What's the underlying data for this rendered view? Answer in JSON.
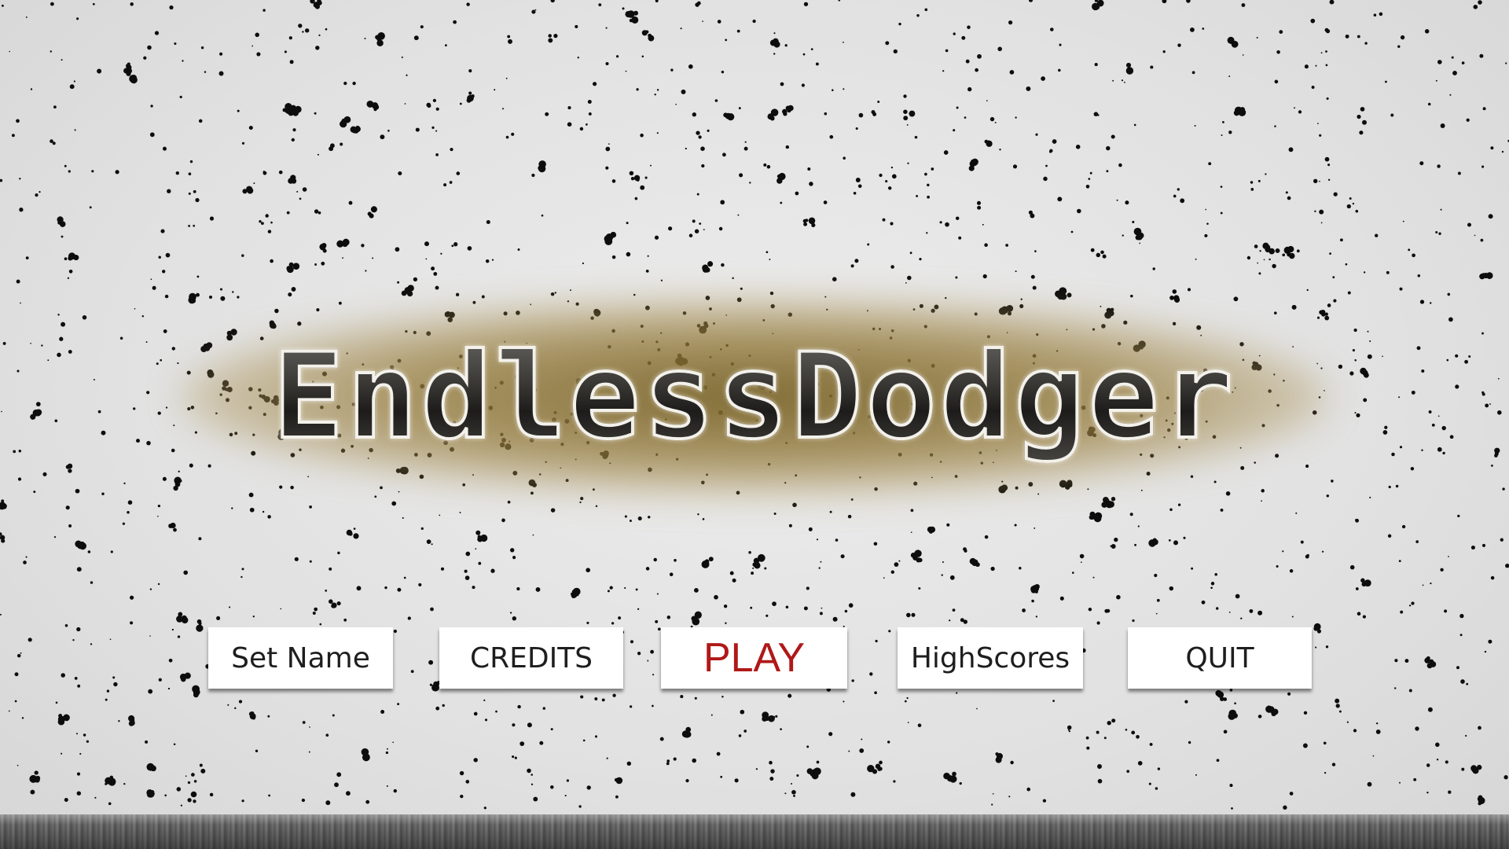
{
  "game": {
    "title": "EndlessDodger"
  },
  "menu": {
    "set_name_label": "Set Name",
    "credits_label": "CREDITS",
    "play_label": "PLAY",
    "highscores_label": "HighScores",
    "quit_label": "QUIT"
  },
  "colors": {
    "background": "#e2e2e2",
    "speckle": "#0d0d0d",
    "title_glow": "#7a6228",
    "play_text": "#b01818",
    "button_text": "#1e1e1e",
    "button_bg": "#ffffff"
  }
}
